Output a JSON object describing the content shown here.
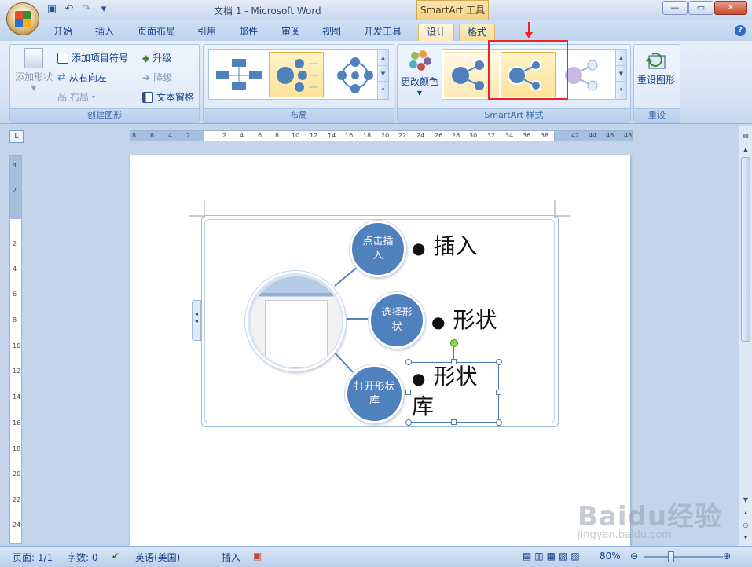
{
  "title_bar": {
    "doc_title": "文档 1 - Microsoft Word",
    "context_title": "SmartArt 工具"
  },
  "tabs": [
    "开始",
    "插入",
    "页面布局",
    "引用",
    "邮件",
    "审阅",
    "视图",
    "开发工具",
    "设计",
    "格式"
  ],
  "ribbon": {
    "create_group": {
      "add_shape": "添加形状",
      "add_bullet": "添加项目符号",
      "rtl": "从右向左",
      "layout": "布局",
      "promote": "升级",
      "demote": "降级",
      "text_pane": "文本窗格",
      "label": "创建图形"
    },
    "layout_group": {
      "label": "布局"
    },
    "style_group": {
      "change_colors": "更改颜色",
      "label": "SmartArt 样式"
    },
    "reset_group": {
      "reset": "重设图形",
      "label": "重设"
    }
  },
  "ruler": {
    "h_ticks": [
      "8",
      "6",
      "4",
      "2",
      "2",
      "4",
      "6",
      "8",
      "10",
      "12",
      "14",
      "16",
      "18",
      "20",
      "22",
      "24",
      "26",
      "28",
      "30",
      "32",
      "34",
      "36",
      "38",
      "42",
      "44",
      "46",
      "48"
    ],
    "v_ticks": [
      "4",
      "2",
      "2",
      "4",
      "6",
      "8",
      "10",
      "12",
      "14",
      "16",
      "18",
      "20",
      "22",
      "24"
    ]
  },
  "smartart": {
    "items": [
      {
        "circle": "点击插入",
        "bullet": "插入"
      },
      {
        "circle": "选择形状",
        "bullet": "形状"
      },
      {
        "circle": "打开形状库",
        "bullet": "形状库"
      }
    ]
  },
  "status": {
    "page": "页面: 1/1",
    "words": "字数: 0",
    "lang": "英语(美国)",
    "mode": "插入",
    "zoom": "80%"
  },
  "watermark": {
    "brand": "Baidu经验",
    "url": "jingyan.baidu.com"
  }
}
